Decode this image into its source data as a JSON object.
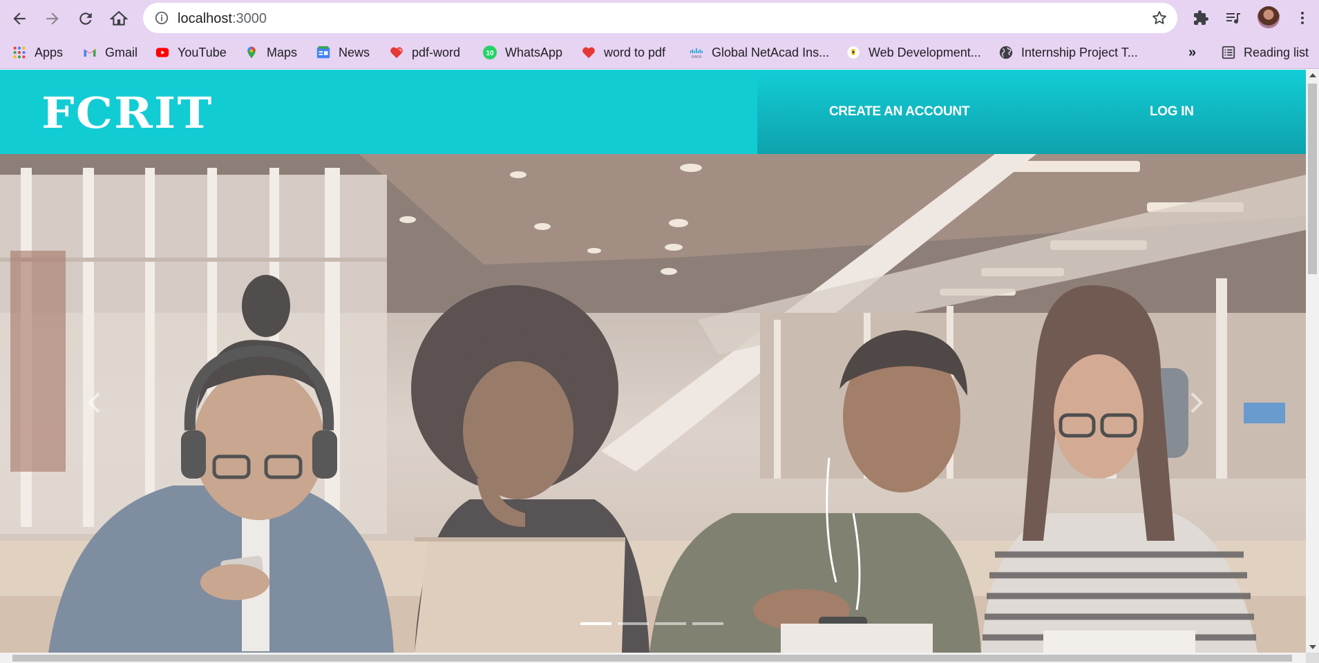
{
  "browser": {
    "url_host": "localhost",
    "url_port": ":3000",
    "bookmarks": [
      {
        "label": "Apps",
        "icon": "apps-grid-icon"
      },
      {
        "label": "Gmail",
        "icon": "gmail-icon"
      },
      {
        "label": "YouTube",
        "icon": "youtube-icon"
      },
      {
        "label": "Maps",
        "icon": "maps-pin-icon"
      },
      {
        "label": "News",
        "icon": "google-news-icon"
      },
      {
        "label": "pdf-word",
        "icon": "heart-icon"
      },
      {
        "label": "WhatsApp",
        "icon": "whatsapp-icon"
      },
      {
        "label": "word to pdf",
        "icon": "heart-icon"
      },
      {
        "label": "Global NetAcad Ins...",
        "icon": "cisco-icon"
      },
      {
        "label": "Web Development...",
        "icon": "web-dev-icon"
      },
      {
        "label": "Internship Project T...",
        "icon": "globe-icon"
      }
    ],
    "overflow_label": "»",
    "reading_list_label": "Reading list",
    "whatsapp_badge": "10"
  },
  "site": {
    "logo": "FCRIT",
    "nav": {
      "create_account": "CREATE AN ACCOUNT",
      "login": "LOG IN"
    },
    "carousel": {
      "slide_count": 4,
      "active_index": 0
    }
  },
  "colors": {
    "chrome_bg": "#e7d3f2",
    "header_bg": "#12ccd4",
    "header_right_bottom": "#0fa2ad"
  }
}
